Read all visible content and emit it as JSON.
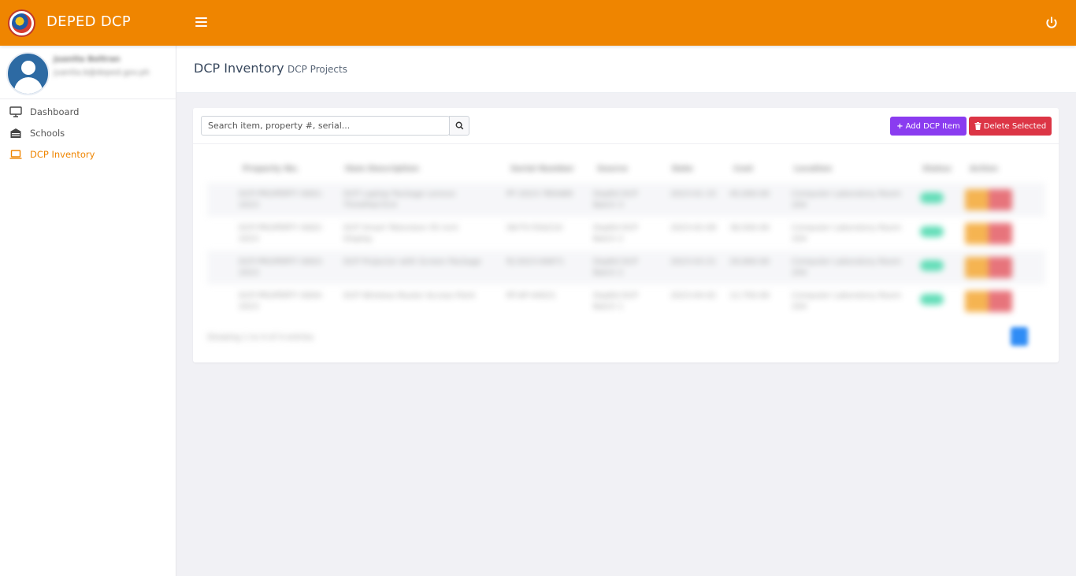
{
  "app": {
    "brand": "DEPED DCP"
  },
  "user": {
    "name": "Juanita Beltran",
    "email": "juanita.b@deped.gov.ph"
  },
  "sidebar": {
    "items": [
      {
        "label": "Dashboard",
        "icon": "monitor-icon",
        "active": false
      },
      {
        "label": "Schools",
        "icon": "school-icon",
        "active": false
      },
      {
        "label": "DCP Inventory",
        "icon": "laptop-icon",
        "active": true
      }
    ]
  },
  "header": {
    "title": "DCP Inventory",
    "subtitle": "DCP Projects"
  },
  "toolbar": {
    "search_placeholder": "Search item, property #, serial...",
    "add_label": "Add DCP Item",
    "delete_label": "Delete Selected"
  },
  "table": {
    "columns": [
      "Property No.",
      "Item Description",
      "Serial Number",
      "Source",
      "Date",
      "Cost",
      "Location",
      "Status",
      "Action"
    ],
    "rows": [
      {
        "property": "DCP-PROPERTY 0001-2023",
        "item": "DCP Laptop Package Lenovo ThinkPad E14",
        "serial": "PF-2023-7B5AB9",
        "source": "DepEd DCP Batch 3",
        "date": "2023-01-15",
        "cost": "45,000.00",
        "location": "Computer Laboratory Room 204",
        "status": "Active"
      },
      {
        "property": "DCP-PROPERTY 0002-2023",
        "item": "DCP Smart Television 55 inch Display",
        "serial": "SN-TV-55A210",
        "source": "DepEd DCP Batch 2",
        "date": "2023-02-09",
        "cost": "38,500.00",
        "location": "Computer Laboratory Room 204",
        "status": "Active"
      },
      {
        "property": "DCP-PROPERTY 0003-2023",
        "item": "DCP Projector with Screen Package",
        "serial": "PJ-2023-00871",
        "source": "DepEd DCP Batch 2",
        "date": "2023-03-21",
        "cost": "29,900.00",
        "location": "Computer Laboratory Room 204",
        "status": "Active"
      },
      {
        "property": "DCP-PROPERTY 0004-2023",
        "item": "DCP Wireless Router Access Point",
        "serial": "RT-AP-44021",
        "source": "DepEd DCP Batch 1",
        "date": "2023-04-02",
        "cost": "12,750.00",
        "location": "Computer Laboratory Room 204",
        "status": "Active"
      }
    ]
  },
  "footer": {
    "info": "Showing 1 to 4 of 4 entries",
    "page": "1"
  },
  "colors": {
    "brand": "#ef8500",
    "add": "#8a3cf0",
    "delete": "#dc3545",
    "status": "#2fd3a1"
  }
}
